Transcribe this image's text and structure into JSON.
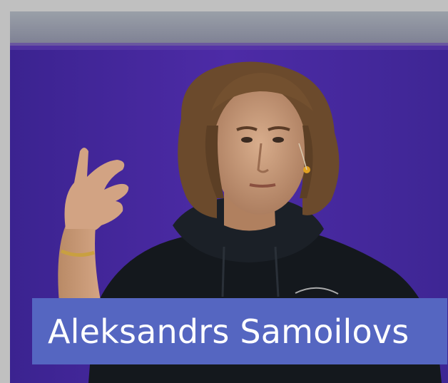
{
  "photo": {
    "subject": "speaker-portrait",
    "colors": {
      "backdrop": "#4a2a9e",
      "hoodie": "#14181d",
      "hair": "#6b4a2c",
      "skin": "#c79a7a"
    }
  },
  "caption": {
    "name": "Aleksandrs Samoilovs",
    "background": "#5566c1",
    "text_color": "#ffffff"
  }
}
